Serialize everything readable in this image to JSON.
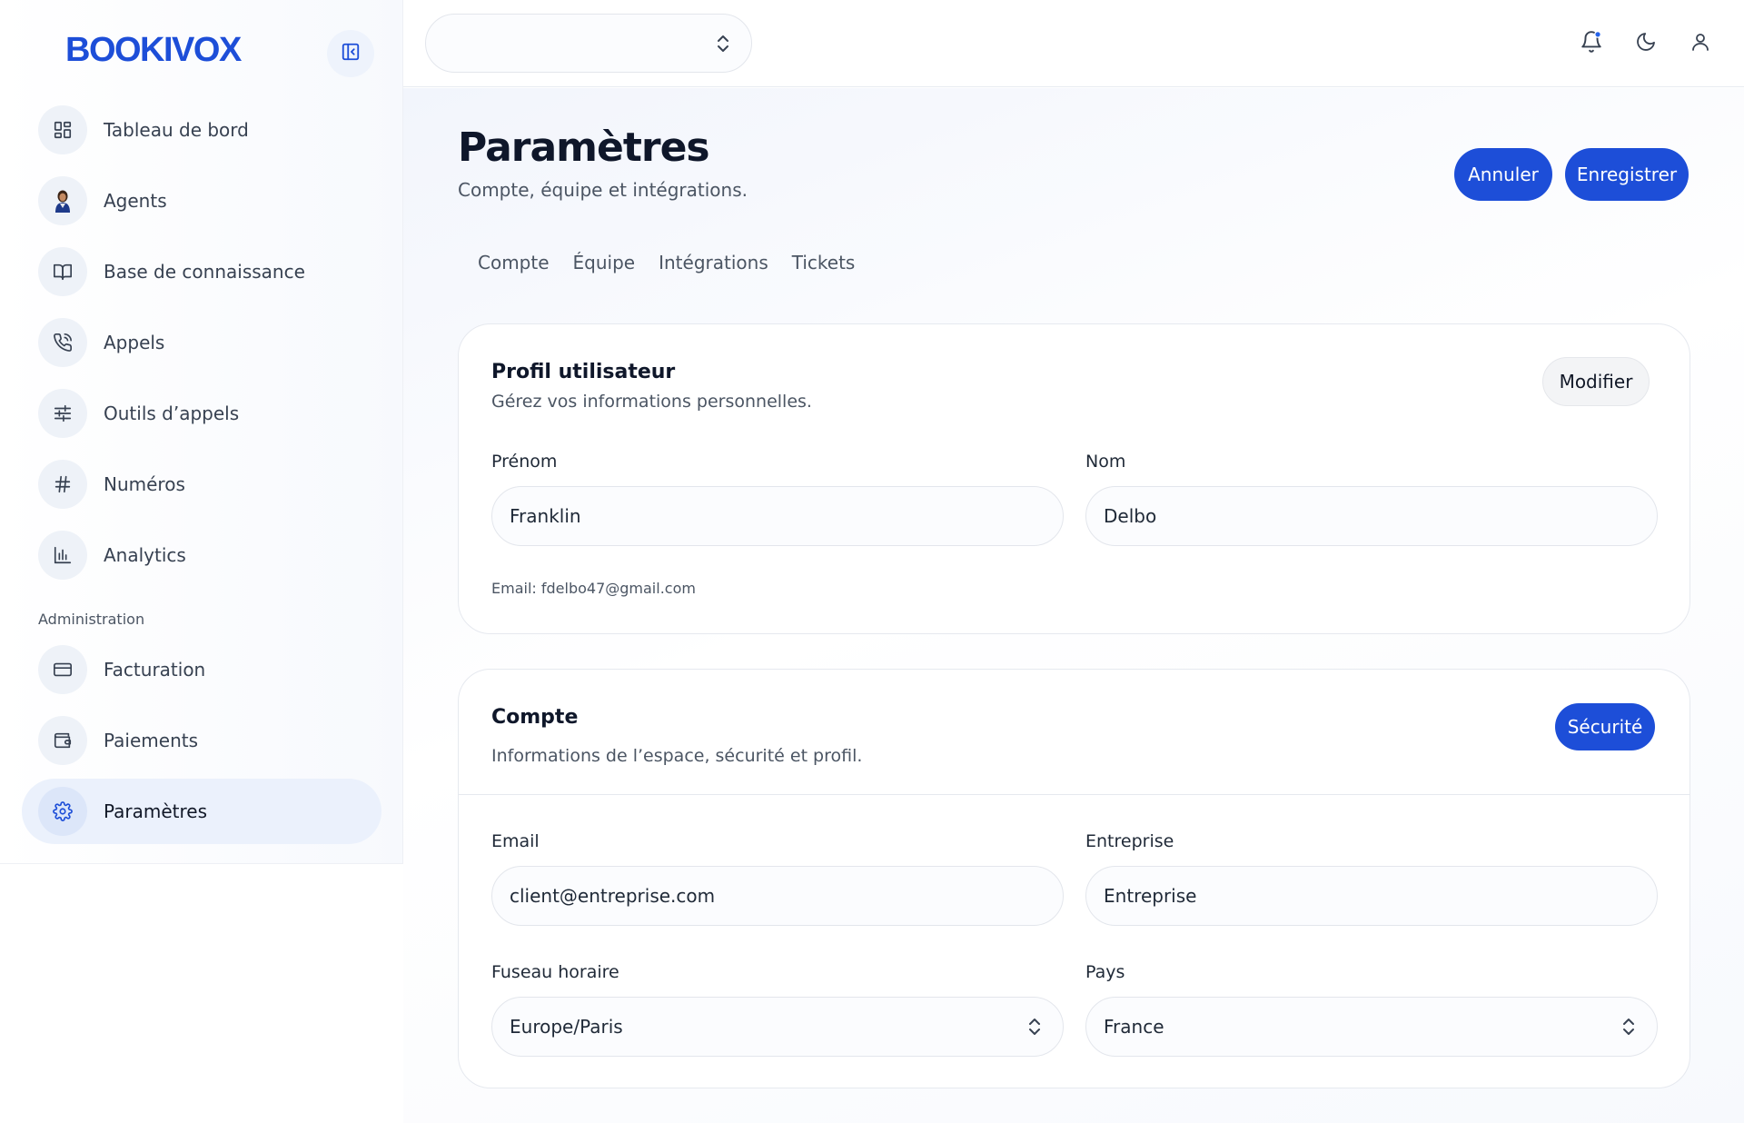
{
  "app": {
    "logo": "BOOKIVOX"
  },
  "sidebar": {
    "items": [
      {
        "label": "Tableau de bord",
        "icon": "dashboard-grid-icon"
      },
      {
        "label": "Agents",
        "icon": "agent-avatar-icon"
      },
      {
        "label": "Base de connaissance",
        "icon": "open-book-icon"
      },
      {
        "label": "Appels",
        "icon": "phone-call-icon"
      },
      {
        "label": "Outils d’appels",
        "icon": "sliders-icon"
      },
      {
        "label": "Numéros",
        "icon": "hash-icon"
      },
      {
        "label": "Analytics",
        "icon": "bar-chart-icon"
      }
    ],
    "section_label": "Administration",
    "admin_items": [
      {
        "label": "Facturation",
        "icon": "credit-card-icon"
      },
      {
        "label": "Paiements",
        "icon": "wallet-icon"
      },
      {
        "label": "Paramètres",
        "icon": "gear-icon",
        "active": true
      }
    ]
  },
  "topbar": {
    "workspace_select_value": "",
    "icons": [
      "bell-icon",
      "moon-icon",
      "user-icon"
    ]
  },
  "page": {
    "title": "Paramètres",
    "subtitle": "Compte, équipe et intégrations.",
    "cancel_label": "Annuler",
    "save_label": "Enregistrer",
    "tabs": [
      "Compte",
      "Équipe",
      "Intégrations",
      "Tickets"
    ]
  },
  "profile_card": {
    "title": "Profil utilisateur",
    "subtitle": "Gérez vos informations personnelles.",
    "edit_label": "Modifier",
    "first_name_label": "Prénom",
    "first_name_value": "Franklin",
    "last_name_label": "Nom",
    "last_name_value": "Delbo",
    "email_note": "Email: fdelbo47@gmail.com"
  },
  "account_card": {
    "title": "Compte",
    "subtitle": "Informations de l’espace, sécurité et profil.",
    "security_label": "Sécurité",
    "email_label": "Email",
    "email_value": "client@entreprise.com",
    "company_label": "Entreprise",
    "company_value": "Entreprise",
    "timezone_label": "Fuseau horaire",
    "timezone_value": "Europe/Paris",
    "country_label": "Pays",
    "country_value": "France"
  },
  "colors": {
    "accent": "#1d4ed8",
    "active_nav_bg": "#ebf1fc",
    "notification_dot": "#2563eb"
  }
}
